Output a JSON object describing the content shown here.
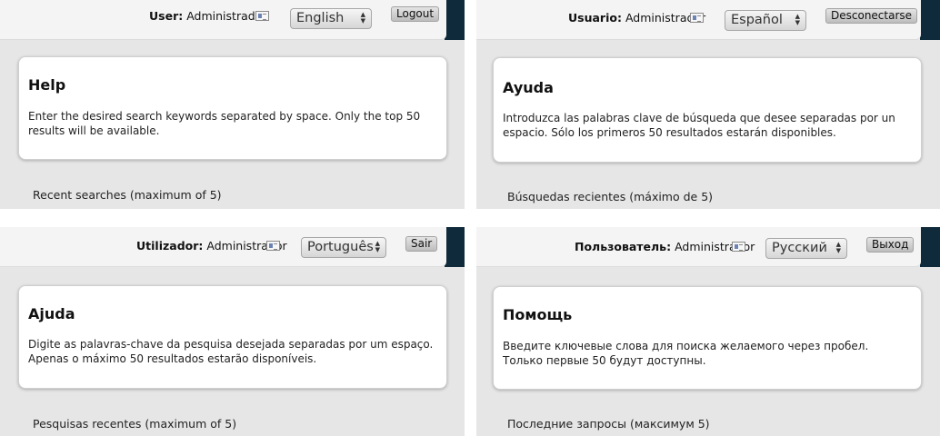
{
  "panels": [
    {
      "user_label": "User:",
      "user_name": "Administrador",
      "language": "English",
      "logout": "Logout",
      "help_title": "Help",
      "help_text": "Enter the desired search keywords separated by space. Only the top 50 results will be available.",
      "recent": "Recent searches (maximum of 5)"
    },
    {
      "user_label": "Usuario:",
      "user_name": "Administrador",
      "language": "Español",
      "logout": "Desconectarse",
      "help_title": "Ayuda",
      "help_text": "Introduzca las palabras clave de búsqueda que desee separadas por un espacio. Sólo los primeros 50 resultados estarán disponibles.",
      "recent": "Búsquedas recientes (máximo de 5)"
    },
    {
      "user_label": "Utilizador:",
      "user_name": "Administrador",
      "language": "Português",
      "logout": "Sair",
      "help_title": "Ajuda",
      "help_text": "Digite as palavras-chave da pesquisa desejada separadas por um espaço. Apenas o máximo 50 resultados estarão disponíveis.",
      "recent": "Pesquisas recentes (maximum of 5)"
    },
    {
      "user_label": "Пользователь:",
      "user_name": "Administrador",
      "language": "Русский",
      "logout": "Выход",
      "help_title": "Помощь",
      "help_text": "Введите ключевые слова для поиска желаемого через пробел. Только первые 50 будут доступны.",
      "recent": "Последние запросы (максимум 5)"
    }
  ],
  "icons": {
    "user_card": "id-card-icon",
    "select_arrows": "updown-arrows-icon"
  },
  "colors": {
    "header_dark": "#0f2a3a",
    "page_bg": "#e6e6e6",
    "card_bg": "#ffffff"
  }
}
